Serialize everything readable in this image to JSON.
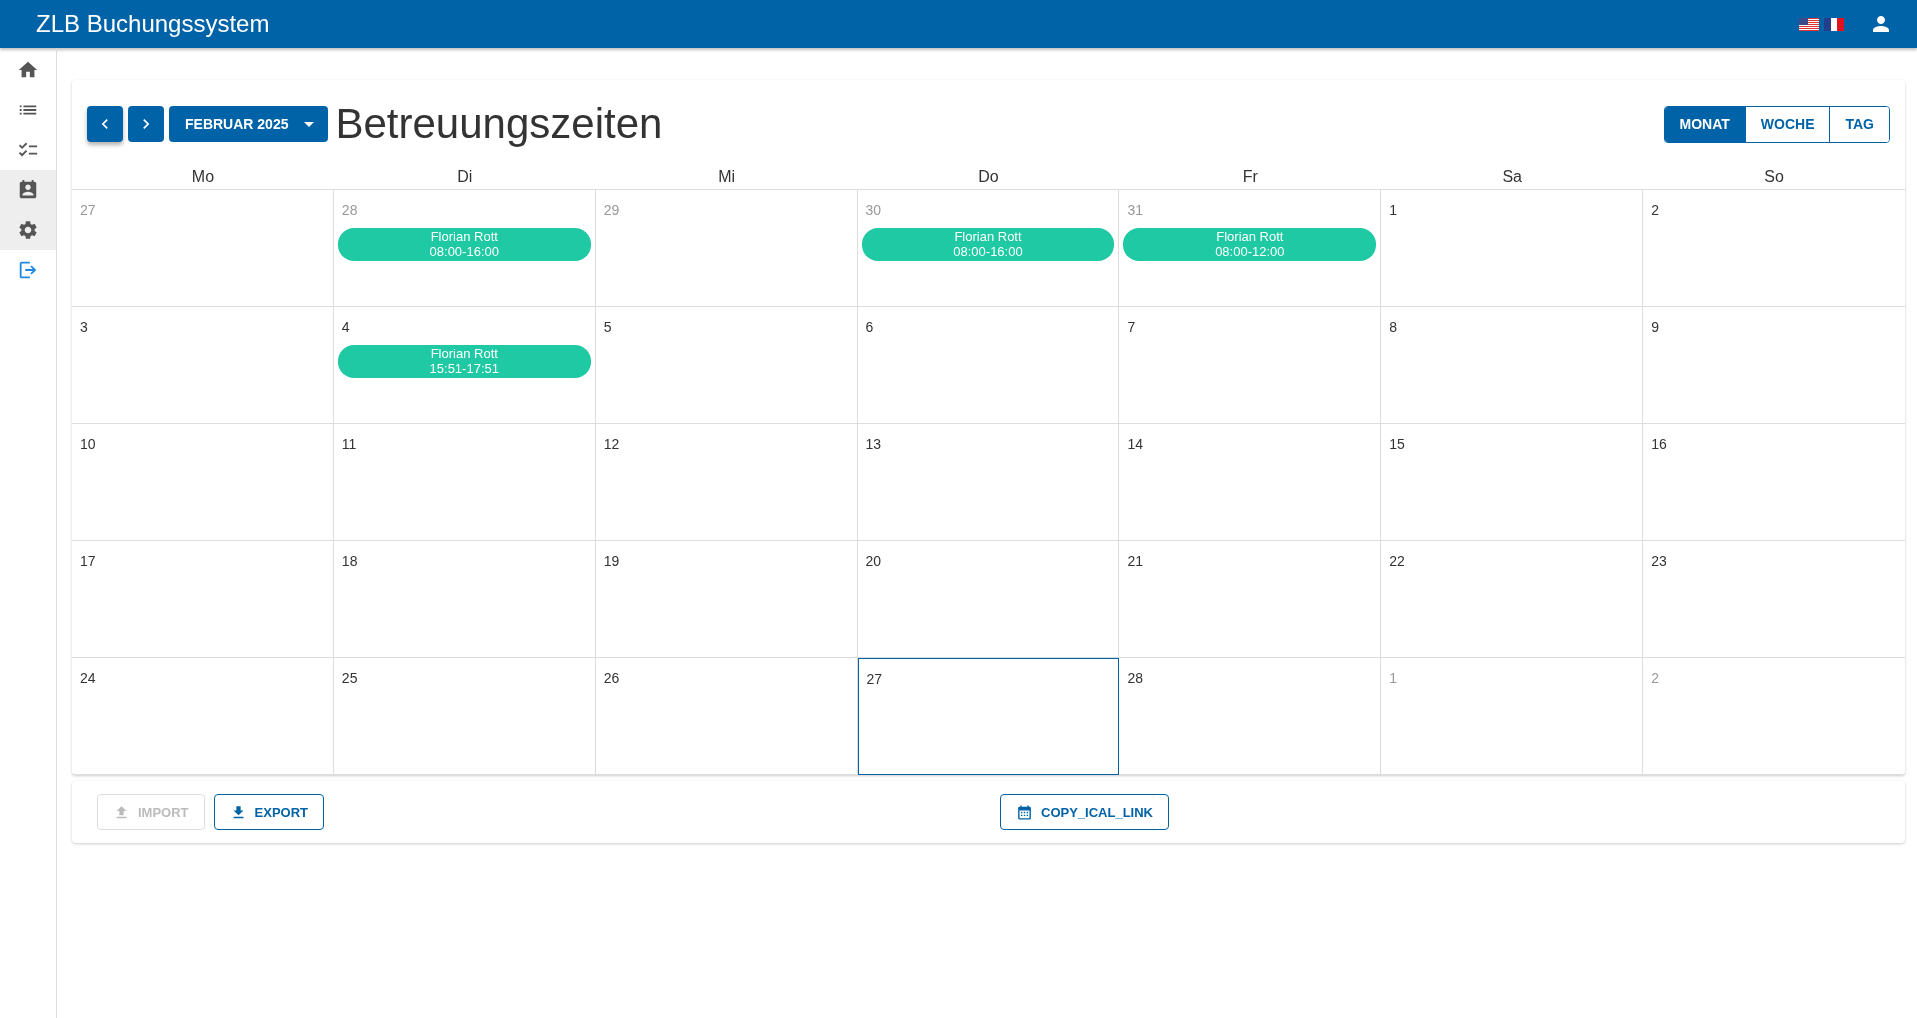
{
  "app_bar": {
    "title": "ZLB Buchungssystem"
  },
  "sidebar": {
    "items": [
      {
        "kind": "home",
        "selected": false
      },
      {
        "kind": "list",
        "selected": false
      },
      {
        "kind": "checklist",
        "selected": false
      },
      {
        "kind": "contact",
        "selected": true
      },
      {
        "kind": "settings",
        "selected": true
      },
      {
        "kind": "logout",
        "selected": false
      }
    ]
  },
  "toolbar": {
    "month_button": "FEBRUAR 2025",
    "title": "Betreuungszeiten",
    "views": [
      {
        "label": "MONAT",
        "selected": true
      },
      {
        "label": "WOCHE",
        "selected": false
      },
      {
        "label": "TAG",
        "selected": false
      }
    ]
  },
  "calendar": {
    "weekdays": [
      "Mo",
      "Di",
      "Mi",
      "Do",
      "Fr",
      "Sa",
      "So"
    ],
    "weeks": [
      [
        {
          "day": "27",
          "outside": true,
          "today": false
        },
        {
          "day": "28",
          "outside": true,
          "today": false,
          "events": [
            {
              "name": "Florian Rott",
              "time": "08:00-16:00"
            }
          ]
        },
        {
          "day": "29",
          "outside": true,
          "today": false
        },
        {
          "day": "30",
          "outside": true,
          "today": false,
          "events": [
            {
              "name": "Florian Rott",
              "time": "08:00-16:00"
            }
          ]
        },
        {
          "day": "31",
          "outside": true,
          "today": false,
          "events": [
            {
              "name": "Florian Rott",
              "time": "08:00-12:00"
            }
          ]
        },
        {
          "day": "1",
          "outside": false,
          "today": false
        },
        {
          "day": "2",
          "outside": false,
          "today": false
        }
      ],
      [
        {
          "day": "3",
          "outside": false,
          "today": false
        },
        {
          "day": "4",
          "outside": false,
          "today": false,
          "events": [
            {
              "name": "Florian Rott",
              "time": "15:51-17:51"
            }
          ]
        },
        {
          "day": "5",
          "outside": false,
          "today": false
        },
        {
          "day": "6",
          "outside": false,
          "today": false
        },
        {
          "day": "7",
          "outside": false,
          "today": false
        },
        {
          "day": "8",
          "outside": false,
          "today": false
        },
        {
          "day": "9",
          "outside": false,
          "today": false
        }
      ],
      [
        {
          "day": "10",
          "outside": false,
          "today": false
        },
        {
          "day": "11",
          "outside": false,
          "today": false
        },
        {
          "day": "12",
          "outside": false,
          "today": false
        },
        {
          "day": "13",
          "outside": false,
          "today": false
        },
        {
          "day": "14",
          "outside": false,
          "today": false
        },
        {
          "day": "15",
          "outside": false,
          "today": false
        },
        {
          "day": "16",
          "outside": false,
          "today": false
        }
      ],
      [
        {
          "day": "17",
          "outside": false,
          "today": false
        },
        {
          "day": "18",
          "outside": false,
          "today": false
        },
        {
          "day": "19",
          "outside": false,
          "today": false
        },
        {
          "day": "20",
          "outside": false,
          "today": false
        },
        {
          "day": "21",
          "outside": false,
          "today": false
        },
        {
          "day": "22",
          "outside": false,
          "today": false
        },
        {
          "day": "23",
          "outside": false,
          "today": false
        }
      ],
      [
        {
          "day": "24",
          "outside": false,
          "today": false
        },
        {
          "day": "25",
          "outside": false,
          "today": false
        },
        {
          "day": "26",
          "outside": false,
          "today": false
        },
        {
          "day": "27",
          "outside": false,
          "today": true
        },
        {
          "day": "28",
          "outside": false,
          "today": false
        },
        {
          "day": "1",
          "outside": true,
          "today": false
        },
        {
          "day": "2",
          "outside": true,
          "today": false
        }
      ]
    ]
  },
  "actions": {
    "import": {
      "label": "IMPORT",
      "disabled": true
    },
    "export": {
      "label": "EXPORT",
      "disabled": false
    },
    "ical": {
      "label": "COPY_ICAL_LINK",
      "disabled": false
    }
  }
}
